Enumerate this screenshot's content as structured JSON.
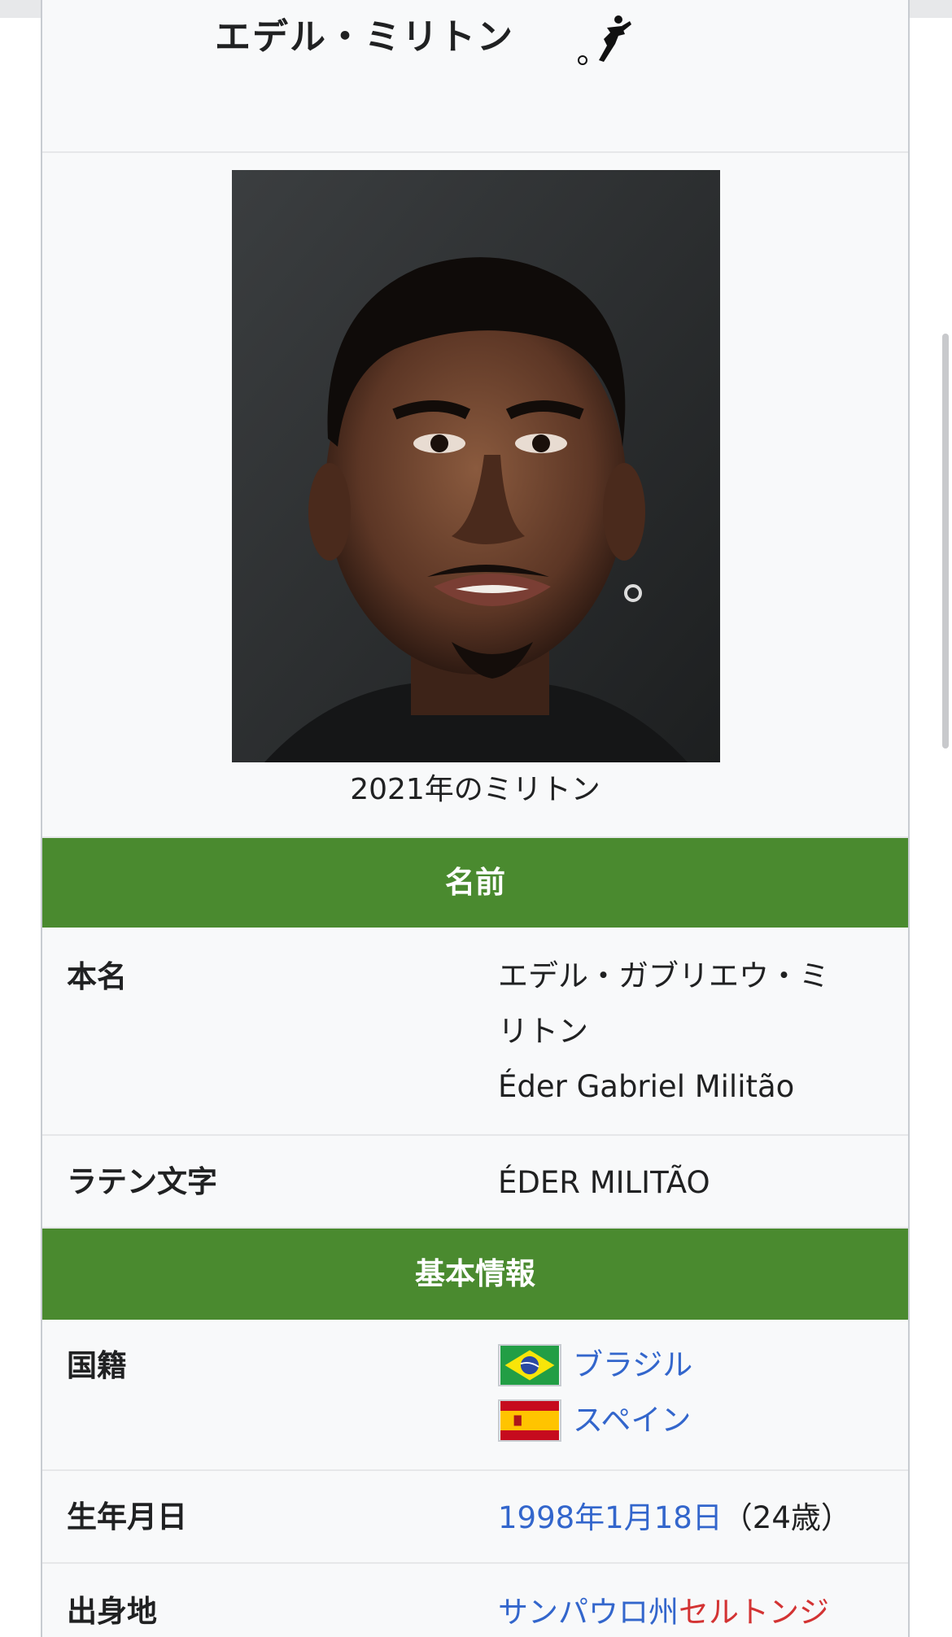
{
  "title": "エデル・ミリトン",
  "photo": {
    "caption": "2021年のミリトン"
  },
  "sections": {
    "name_header": "名前",
    "basic_header": "基本情報"
  },
  "fields": {
    "real_name": {
      "label": "本名",
      "value_line1": "エデル・ガブリエウ・ミ",
      "value_line2": "リトン",
      "value_line3": "Éder Gabriel Militão"
    },
    "latin": {
      "label": "ラテン文字",
      "value": "ÉDER MILITÃO"
    },
    "nationality": {
      "label": "国籍",
      "country1": "ブラジル",
      "country2": "スペイン"
    },
    "birth": {
      "label": "生年月日",
      "date": "1998年1月18日",
      "age": "（24歳）"
    },
    "birthplace": {
      "label": "出身地",
      "state": "サンパウロ州",
      "city": "セルトンジ"
    }
  },
  "colors": {
    "header_green": "#4a8a2f",
    "link_blue": "#3366cc",
    "red_link": "#d33333"
  }
}
